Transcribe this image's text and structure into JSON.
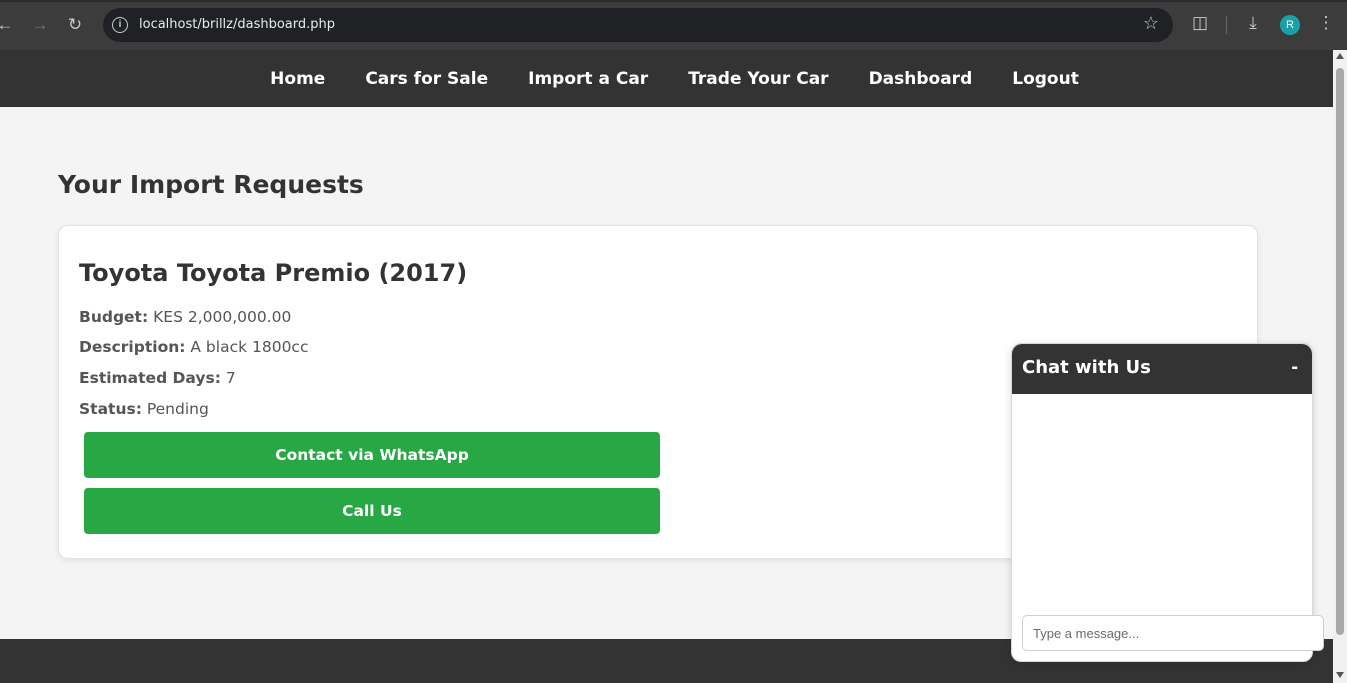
{
  "browser": {
    "url": "localhost/brillz/dashboard.php",
    "avatar_letter": "R"
  },
  "nav": {
    "items": [
      "Home",
      "Cars for Sale",
      "Import a Car",
      "Trade Your Car",
      "Dashboard",
      "Logout"
    ]
  },
  "main": {
    "page_title": "Your Import Requests",
    "request": {
      "title": "Toyota Toyota Premio (2017)",
      "budget_label": "Budget:",
      "budget_value": "KES 2,000,000.00",
      "description_label": "Description:",
      "description_value": "A black 1800cc",
      "days_label": "Estimated Days:",
      "days_value": "7",
      "status_label": "Status:",
      "status_value": "Pending",
      "whatsapp_button": "Contact via WhatsApp",
      "call_button": "Call Us"
    }
  },
  "chat": {
    "title": "Chat with Us",
    "minimize": "-",
    "input_placeholder": "Type a message..."
  },
  "colors": {
    "header_bg": "#333333",
    "page_bg": "#f4f4f4",
    "button_green": "#28a745"
  }
}
